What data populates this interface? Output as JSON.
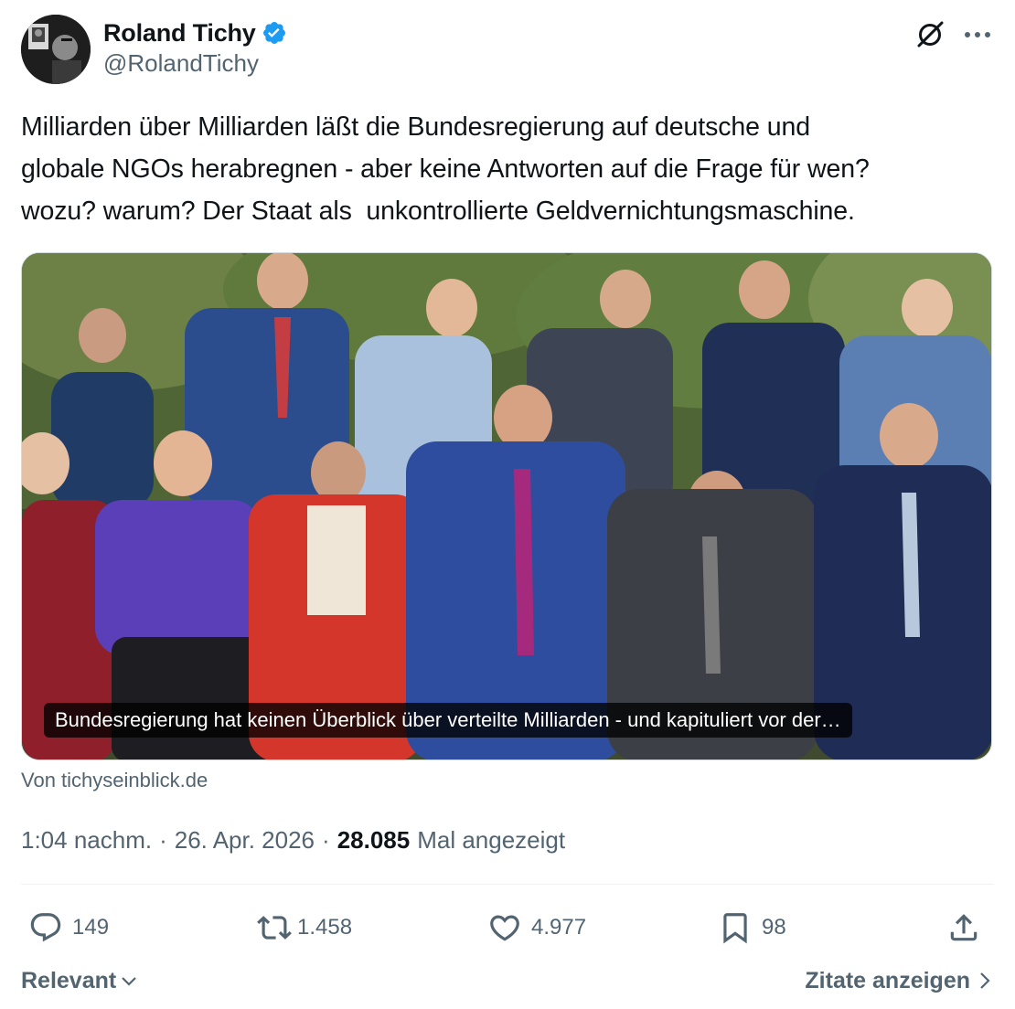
{
  "author": {
    "display_name": "Roland Tichy",
    "handle": "@RolandTichy",
    "verified": true
  },
  "tweet": {
    "text": "Milliarden über Milliarden läßt die Bundesregierung auf deutsche und\nglobale NGOs herabregnen - aber keine Antworten auf die Frage für wen?\nwozu? warum? Der Staat als  unkontrollierte Geldvernichtungsmaschine."
  },
  "card": {
    "caption": "Bundesregierung hat keinen Überblick über verteilte Milliarden - und kapituliert vor der…",
    "source": "Von tichyseinblick.de"
  },
  "meta": {
    "time": "1:04 nachm.",
    "date": "26. Apr. 2026",
    "separator": "·",
    "views_count": "28.085",
    "views_label": "Mal angezeigt"
  },
  "actions": {
    "replies": "149",
    "retweets": "1.458",
    "likes": "4.977",
    "bookmarks": "98"
  },
  "footer": {
    "sort_label": "Relevant",
    "quotes_label": "Zitate anzeigen"
  },
  "icons": [
    "grok-icon",
    "more-icon",
    "verified-badge-icon",
    "reply-icon",
    "retweet-icon",
    "like-icon",
    "bookmark-icon",
    "share-icon",
    "chevron-down-icon",
    "chevron-right-icon"
  ],
  "colors": {
    "text": "#0f1419",
    "secondary": "#536471",
    "verified": "#1d9bf0",
    "divider": "#eff3f4"
  }
}
